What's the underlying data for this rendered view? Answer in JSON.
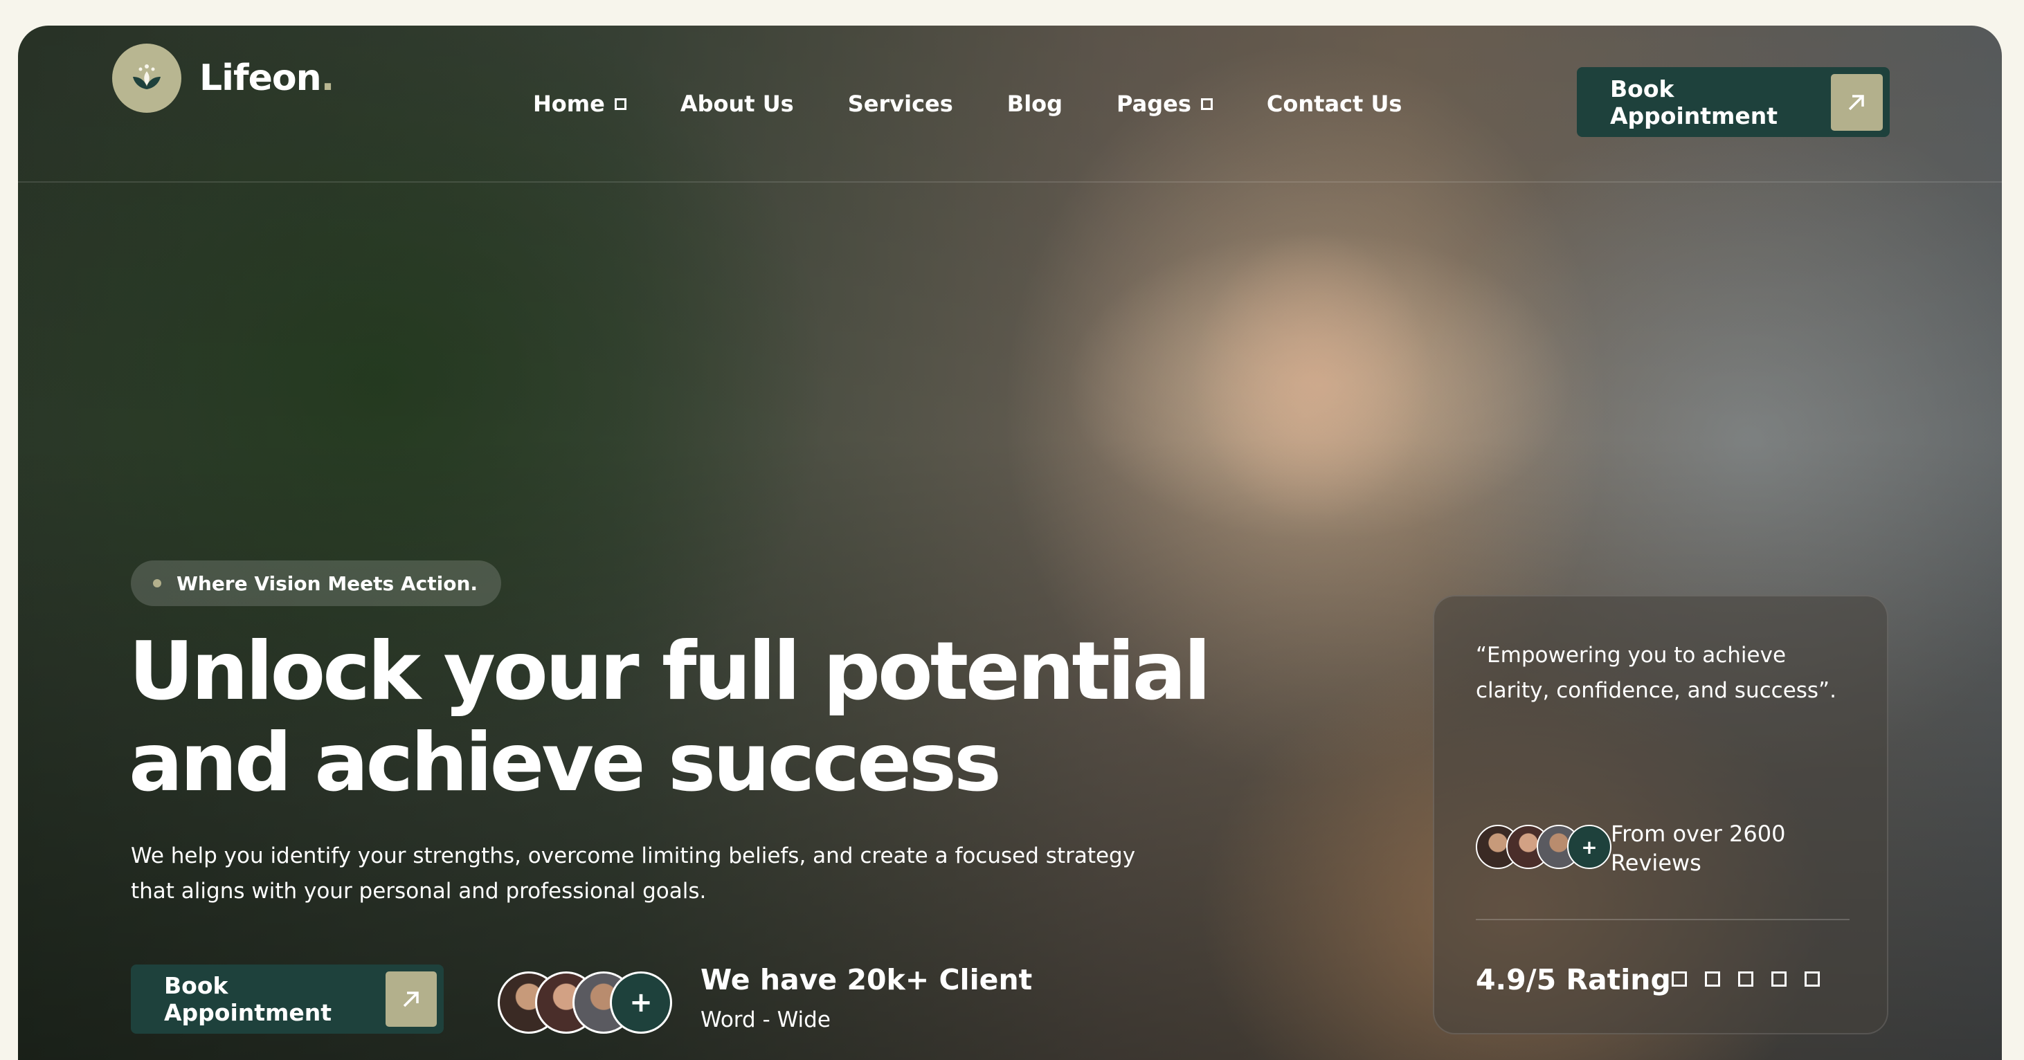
{
  "brand": {
    "name": "Lifeon",
    "suffix": ".",
    "logo_icon": "lotus-leaf-icon"
  },
  "nav": {
    "items": [
      {
        "label": "Home",
        "has_dropdown": true
      },
      {
        "label": "About Us",
        "has_dropdown": false
      },
      {
        "label": "Services",
        "has_dropdown": false
      },
      {
        "label": "Blog",
        "has_dropdown": false
      },
      {
        "label": "Pages",
        "has_dropdown": true
      },
      {
        "label": "Contact Us",
        "has_dropdown": false
      }
    ],
    "cta_label": "Book Appointment"
  },
  "hero": {
    "tag": "Where Vision Meets Action.",
    "headline_line1": "Unlock your full potential",
    "headline_line2": "and achieve success",
    "subtext": "We help you identify your strengths, overcome limiting beliefs, and create a focused strategy that aligns with your personal and professional goals.",
    "cta_label": "Book Appointment",
    "clients_title": "We have 20k+ Client",
    "clients_sub": "Word - Wide",
    "avatar_plus": "+"
  },
  "testimonial": {
    "quote": "“Empowering you to achieve clarity, confidence, and success”.",
    "reviews_line1": "From over 2600",
    "reviews_line2": "Reviews",
    "rating": "4.9/5 Rating",
    "avatar_plus": "+"
  },
  "colors": {
    "accent_dark": "#1e413c",
    "accent_light": "#b3b08c",
    "page_bg": "#f7f5ec"
  }
}
